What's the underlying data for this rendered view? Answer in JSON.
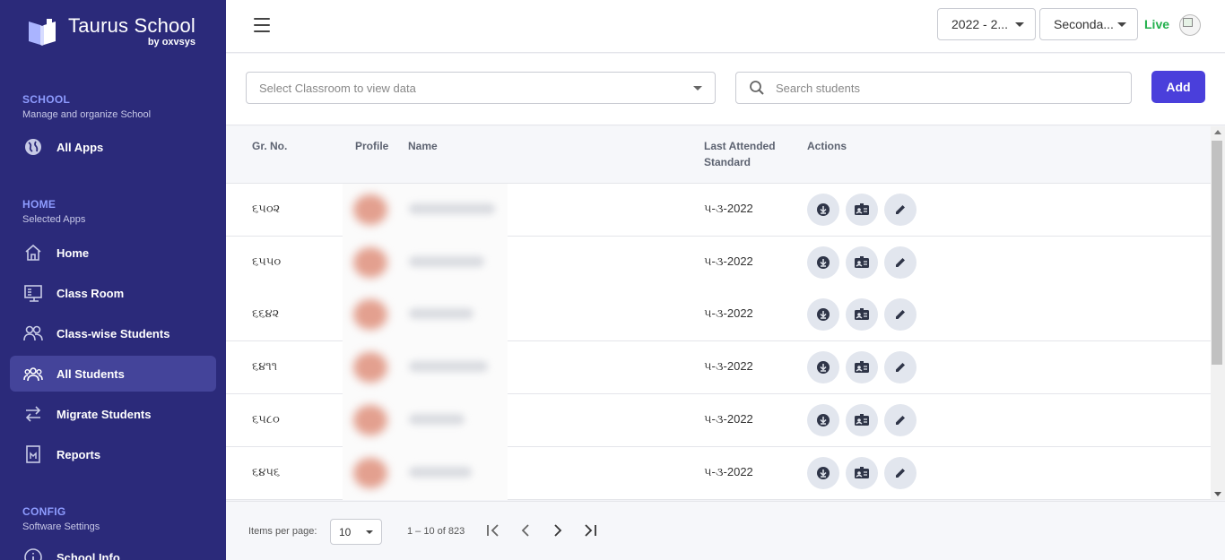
{
  "brand": {
    "name": "Taurus School",
    "by": "by oxvsys"
  },
  "sidebar": {
    "sections": [
      {
        "title": "SCHOOL",
        "subtitle": "Manage and organize School"
      },
      {
        "title": "HOME",
        "subtitle": "Selected Apps"
      },
      {
        "title": "CONFIG",
        "subtitle": "Software Settings"
      }
    ],
    "items": [
      {
        "label": "All Apps",
        "icon": "globe-icon"
      },
      {
        "label": "Home",
        "icon": "home-icon"
      },
      {
        "label": "Class Room",
        "icon": "classroom-icon"
      },
      {
        "label": "Class-wise Students",
        "icon": "users-icon"
      },
      {
        "label": "All Students",
        "icon": "group-icon",
        "active": true
      },
      {
        "label": "Migrate Students",
        "icon": "swap-icon"
      },
      {
        "label": "Reports",
        "icon": "report-icon"
      },
      {
        "label": "School Info",
        "icon": "info-icon"
      }
    ]
  },
  "topbar": {
    "year_select": "2022 - 2...",
    "level_select": "Seconda...",
    "status": "Live"
  },
  "filters": {
    "classroom_placeholder": "Select Classroom to view data",
    "search_placeholder": "Search students",
    "add_label": "Add"
  },
  "table": {
    "headers": {
      "gr_no": "Gr. No.",
      "profile": "Profile",
      "name": "Name",
      "last_attended_line1": "Last Attended",
      "last_attended_line2": "Standard",
      "actions": "Actions"
    },
    "rows": [
      {
        "gr_no": "૬૫૦૨",
        "standard": "૫-૩-2022"
      },
      {
        "gr_no": "૬૫૫૦",
        "standard": "૫-૩-2022"
      },
      {
        "gr_no": "૬૬૪૨",
        "standard": "૫-૩-2022"
      },
      {
        "gr_no": "૬૪૧૧",
        "standard": "૫-૩-2022"
      },
      {
        "gr_no": "૬૫૮૦",
        "standard": "૫-૩-2022"
      },
      {
        "gr_no": "૬૪૫૬",
        "standard": "૫-૩-2022"
      }
    ]
  },
  "paginator": {
    "label": "Items per page:",
    "page_size": "10",
    "range": "1 – 10 of 823"
  },
  "colors": {
    "sidebar_bg": "#2b2a7a",
    "accent": "#4a3fdb",
    "live": "#22b04c",
    "section_title": "#8e9cff"
  }
}
